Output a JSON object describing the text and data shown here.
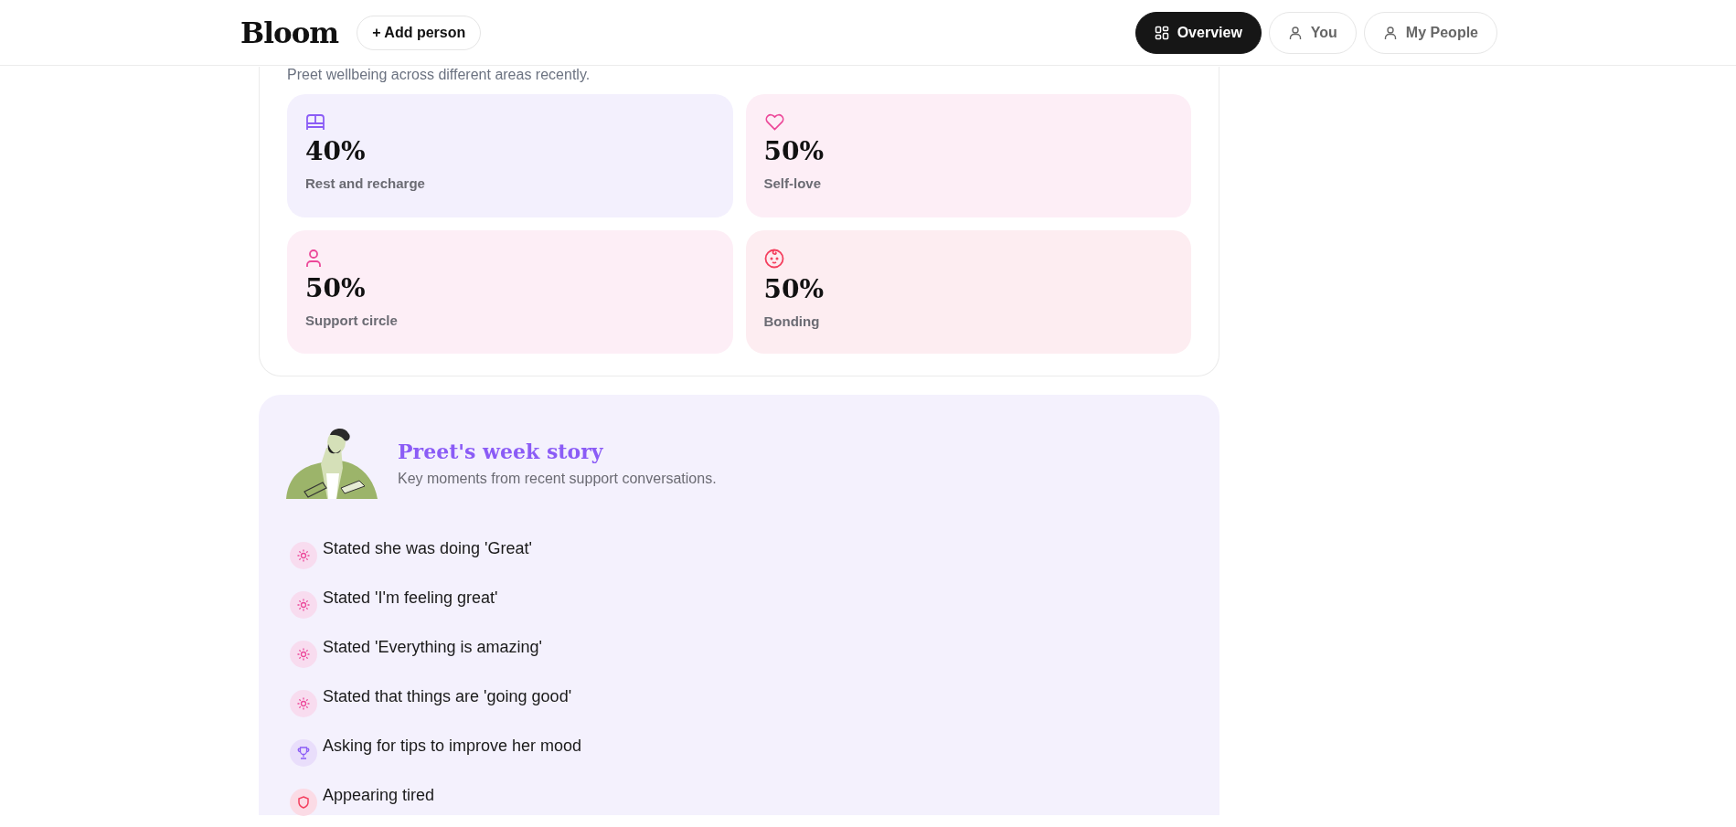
{
  "header": {
    "logo": "Bloom",
    "add_button": "+ Add person",
    "nav": [
      {
        "label": "Overview",
        "kind": "grid",
        "selected": true
      },
      {
        "label": "You",
        "kind": "person",
        "selected": false
      },
      {
        "label": "My People",
        "kind": "person",
        "selected": false
      }
    ]
  },
  "wellbeing": {
    "subtitle": "Preet wellbeing across different areas recently.",
    "areas": [
      {
        "kind": "bed",
        "value": "40%",
        "label": "Rest and recharge"
      },
      {
        "kind": "heart",
        "value": "50%",
        "label": "Self-love"
      },
      {
        "kind": "person",
        "value": "50%",
        "label": "Support circle"
      },
      {
        "kind": "baby",
        "value": "50%",
        "label": "Bonding"
      }
    ]
  },
  "story": {
    "title": "Preet's week story",
    "subtitle": "Key moments from recent support conversations.",
    "moments": [
      {
        "kind": "sun",
        "text": "Stated she was doing 'Great'"
      },
      {
        "kind": "sun",
        "text": "Stated 'I'm feeling great'"
      },
      {
        "kind": "sun",
        "text": "Stated 'Everything is amazing'"
      },
      {
        "kind": "sun",
        "text": "Stated that things are 'going good'"
      },
      {
        "kind": "trophy",
        "text": "Asking for tips to improve her mood"
      },
      {
        "kind": "shield",
        "text": "Appearing tired"
      }
    ]
  }
}
